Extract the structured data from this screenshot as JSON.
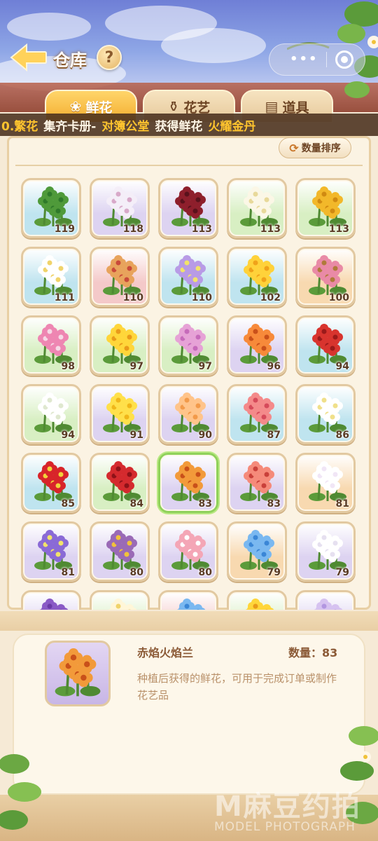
{
  "header": {
    "title": "仓库",
    "help_label": "?",
    "mini_program_dots": "•••"
  },
  "tabs": [
    {
      "label": "鲜花",
      "icon": "rose-icon",
      "active": true
    },
    {
      "label": "花艺",
      "icon": "vase-icon",
      "active": false
    },
    {
      "label": "道具",
      "icon": "box-icon",
      "active": false
    }
  ],
  "ticker": {
    "parts": [
      "0.繁花",
      "集齐卡册-",
      "对簿公堂",
      "获得鲜花",
      "火耀金丹"
    ]
  },
  "sort_button": {
    "label": "数量排序"
  },
  "grid": {
    "items": [
      {
        "flower": "fern",
        "count": "119",
        "bg": "#bfe4ef",
        "petal": "#4f9a3a",
        "center": "#2f7a2a"
      },
      {
        "flower": "white-orchid",
        "count": "118",
        "bg": "#ddd3f1",
        "petal": "#f4eef8",
        "center": "#d8a9c9"
      },
      {
        "flower": "dark-red-bloom",
        "count": "113",
        "bg": "#ddd3f1",
        "petal": "#8e1f2c",
        "center": "#5a121c"
      },
      {
        "flower": "gardenia",
        "count": "113",
        "bg": "#d8efc3",
        "petal": "#fbf7e6",
        "center": "#e8d99a"
      },
      {
        "flower": "yellow-chrysanthemum",
        "count": "113",
        "bg": "#d8efc3",
        "petal": "#f2b82a",
        "center": "#d08a12"
      },
      {
        "flower": "white-jasmine",
        "count": "111",
        "bg": "#bfe4ef",
        "petal": "#ffffff",
        "center": "#f0d36a"
      },
      {
        "flower": "cat-in-costume",
        "count": "110",
        "bg": "#f4c9c9",
        "petal": "#e8a35c",
        "center": "#c94a3a"
      },
      {
        "flower": "african-violet",
        "count": "110",
        "bg": "#bfe4ef",
        "petal": "#b89be6",
        "center": "#f2e36a"
      },
      {
        "flower": "yellow-rose",
        "count": "102",
        "bg": "#bfe4ef",
        "petal": "#ffd23a",
        "center": "#f0a21a"
      },
      {
        "flower": "basket-flowers",
        "count": "100",
        "bg": "#f8d9b0",
        "petal": "#e98aa6",
        "center": "#b07a3a"
      },
      {
        "flower": "pink-lily",
        "count": "98",
        "bg": "#d8efc3",
        "petal": "#ee86b2",
        "center": "#f6d9e6"
      },
      {
        "flower": "yellow-lily",
        "count": "97",
        "bg": "#d8efc3",
        "petal": "#ffd63a",
        "center": "#e99a1a"
      },
      {
        "flower": "hyacinth",
        "count": "97",
        "bg": "#d8efc3",
        "petal": "#e6a2d6",
        "center": "#c66aba"
      },
      {
        "flower": "orange-poppy",
        "count": "96",
        "bg": "#ddd3f1",
        "petal": "#f78a3a",
        "center": "#c9501a"
      },
      {
        "flower": "red-chrysanthemum",
        "count": "94",
        "bg": "#bfe4ef",
        "petal": "#d8342e",
        "center": "#9a1a1a"
      },
      {
        "flower": "lily-of-valley",
        "count": "94",
        "bg": "#d8efc3",
        "petal": "#ffffff",
        "center": "#dfe8cf"
      },
      {
        "flower": "yellow-primrose",
        "count": "91",
        "bg": "#ddd3f1",
        "petal": "#ffe04a",
        "center": "#f0b61a"
      },
      {
        "flower": "peach-primrose",
        "count": "90",
        "bg": "#ddd3f1",
        "petal": "#ffc48a",
        "center": "#f29a4a"
      },
      {
        "flower": "coral-rose",
        "count": "87",
        "bg": "#bfe4ef",
        "petal": "#f48a8a",
        "center": "#d64a5a"
      },
      {
        "flower": "white-wildflower",
        "count": "86",
        "bg": "#bfe4ef",
        "petal": "#ffffff",
        "center": "#f0e08a"
      },
      {
        "flower": "poinsettia",
        "count": "85",
        "bg": "#bfe4ef",
        "petal": "#d8242a",
        "center": "#f2d23a"
      },
      {
        "flower": "red-rose",
        "count": "84",
        "bg": "#d8efc3",
        "petal": "#d42a2e",
        "center": "#8e1218"
      },
      {
        "flower": "fire-orchid",
        "count": "83",
        "bg": "#ddd3f1",
        "petal": "#f29a3a",
        "center": "#c9501a",
        "selected": true
      },
      {
        "flower": "coral-poppy",
        "count": "83",
        "bg": "#ddd3f1",
        "petal": "#f58a7a",
        "center": "#c9403a"
      },
      {
        "flower": "white-magnolia",
        "count": "81",
        "bg": "#f8d9b0",
        "petal": "#ffffff",
        "center": "#f1e6f6"
      },
      {
        "flower": "purple-pansy",
        "count": "81",
        "bg": "#ddd3f1",
        "petal": "#8a6ad6",
        "center": "#f2e36a"
      },
      {
        "flower": "iris",
        "count": "80",
        "bg": "#ddd3f1",
        "petal": "#9a6ab6",
        "center": "#f2c23a"
      },
      {
        "flower": "pink-amaryllis",
        "count": "80",
        "bg": "#ddd3f1",
        "petal": "#f4a6b6",
        "center": "#ffffff"
      },
      {
        "flower": "blue-rose",
        "count": "79",
        "bg": "#f8d9b0",
        "petal": "#7ab8f0",
        "center": "#3a86d6"
      },
      {
        "flower": "white-lily",
        "count": "79",
        "bg": "#ddd3f1",
        "petal": "#ffffff",
        "center": "#e6e0f0"
      },
      {
        "flower": "purple-allium",
        "count": "",
        "bg": "#ddd3f1",
        "petal": "#8a5ac6",
        "center": "#6a3aa6"
      },
      {
        "flower": "small-white",
        "count": "",
        "bg": "#d8efc3",
        "petal": "#fff6d8",
        "center": "#f0d36a"
      },
      {
        "flower": "blue-bloom",
        "count": "",
        "bg": "#f4c9c9",
        "petal": "#7ab8f0",
        "center": "#3a86d6"
      },
      {
        "flower": "yellow-bloom",
        "count": "",
        "bg": "#d8efc3",
        "petal": "#ffd63a",
        "center": "#e99a1a"
      },
      {
        "flower": "lilac-bloom",
        "count": "",
        "bg": "#ddd3f1",
        "petal": "#d6c2f0",
        "center": "#b296e0"
      }
    ]
  },
  "detail": {
    "name": "赤焰火焰兰",
    "quantity": "数量：83",
    "description": "种植后获得的鲜花，可用于完成订单或制作花艺品"
  },
  "watermark": {
    "brand": "M麻豆约拍",
    "sub": "MODEL PHOTOGRAPH"
  }
}
